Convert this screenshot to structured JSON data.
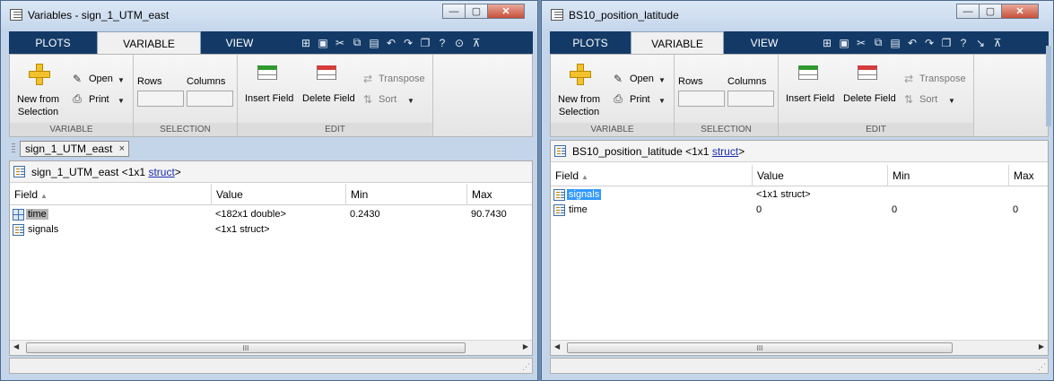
{
  "windows": [
    {
      "title": "Variables - sign_1_UTM_east",
      "tabs": [
        "PLOTS",
        "VARIABLE",
        "VIEW"
      ],
      "active_tab": "VARIABLE",
      "ribbon": {
        "new_from_selection": "New from\nSelection",
        "open": "Open",
        "print": "Print",
        "rows": "Rows",
        "columns": "Columns",
        "insert_field": "Insert Field",
        "delete_field": "Delete Field",
        "transpose": "Transpose",
        "sort": "Sort",
        "section_variable": "VARIABLE",
        "section_selection": "SELECTION",
        "section_edit": "EDIT"
      },
      "doc_tab": "sign_1_UTM_east",
      "doc_tab_close": "×",
      "var_path_name": "sign_1_UTM_east",
      "var_path_pre": "<1x1",
      "var_path_link": "struct",
      "var_path_post": ">",
      "columns": [
        "Field",
        "Value",
        "Min",
        "Max"
      ],
      "rows": [
        {
          "field": "time",
          "value": "<182x1 double>",
          "min": "0.2430",
          "max": "90.7430",
          "icon": "double-grid-icon"
        },
        {
          "field": "signals",
          "value": "<1x1 struct>",
          "min": "",
          "max": "",
          "icon": "struct-icon"
        }
      ],
      "scroll_grip": "III"
    },
    {
      "title": "BS10_position_latitude",
      "tabs": [
        "PLOTS",
        "VARIABLE",
        "VIEW"
      ],
      "active_tab": "VARIABLE",
      "ribbon": {
        "new_from_selection": "New from\nSelection",
        "open": "Open",
        "print": "Print",
        "rows": "Rows",
        "columns": "Columns",
        "insert_field": "Insert Field",
        "delete_field": "Delete Field",
        "transpose": "Transpose",
        "sort": "Sort",
        "section_variable": "VARIABLE",
        "section_selection": "SELECTION",
        "section_edit": "EDIT"
      },
      "var_path_name": "BS10_position_latitude",
      "var_path_pre": "<1x1",
      "var_path_link": "struct",
      "var_path_post": ">",
      "columns": [
        "Field",
        "Value",
        "Min",
        "Max"
      ],
      "rows": [
        {
          "field": "signals",
          "value": "<1x1 struct>",
          "min": "",
          "max": "",
          "icon": "struct-icon"
        },
        {
          "field": "time",
          "value": "0",
          "min": "0",
          "max": "0",
          "icon": "struct-icon"
        }
      ],
      "scroll_grip": "III"
    }
  ],
  "colors": {
    "tabstrip": "#133a67",
    "selection_blue": "#3399ff",
    "selection_gray": "#b6b6b6",
    "link": "#1a2db0"
  }
}
